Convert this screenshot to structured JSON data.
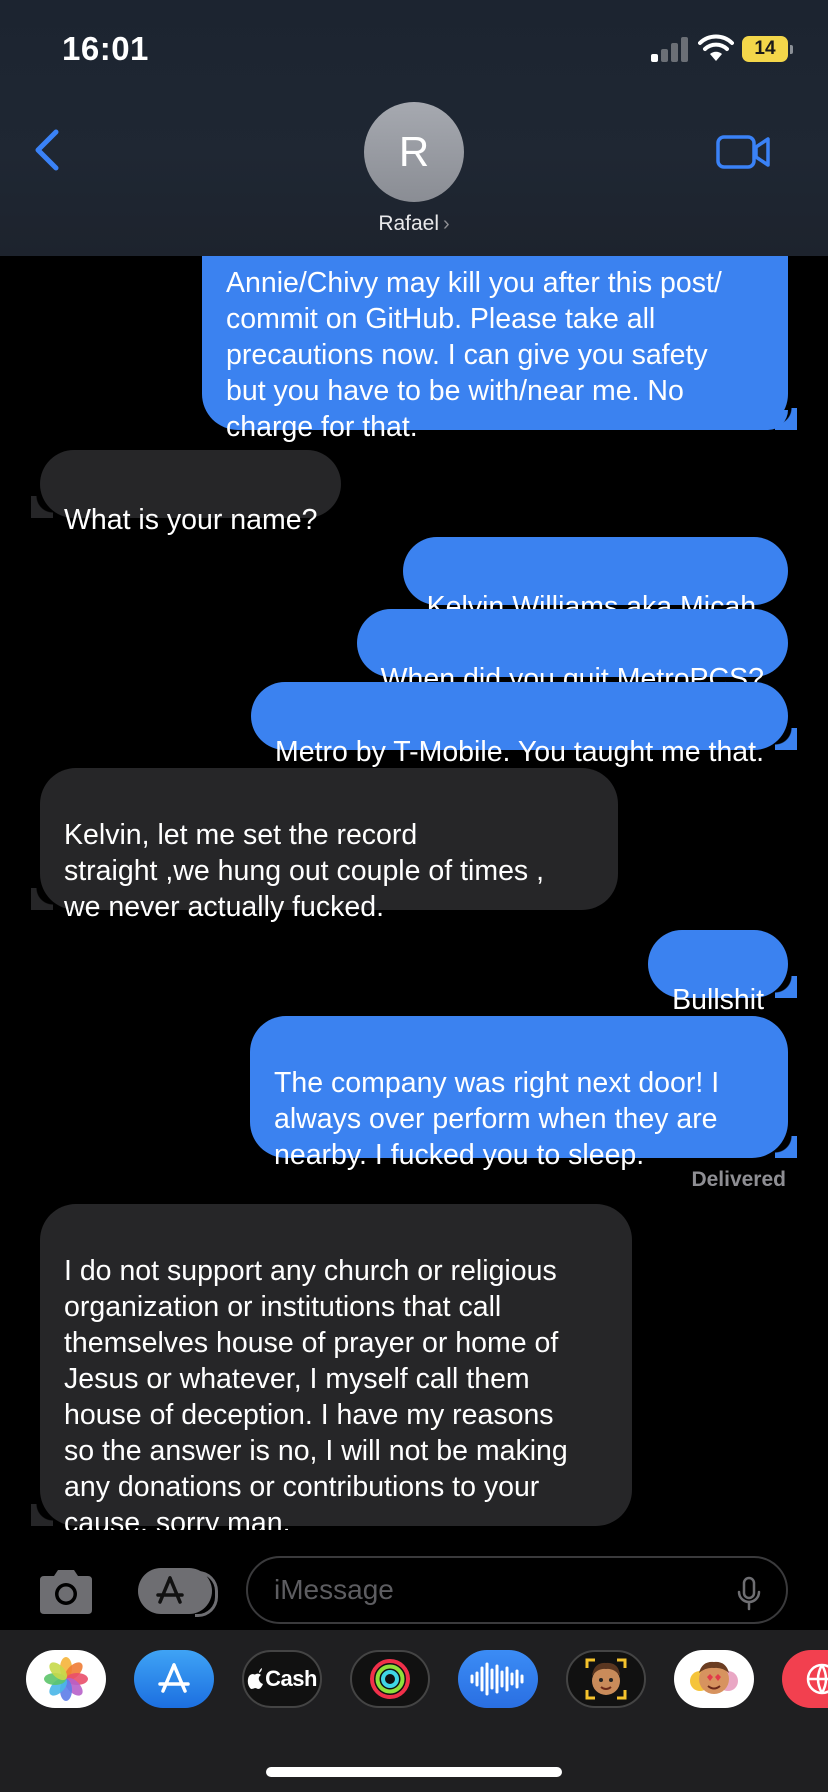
{
  "status_bar": {
    "time": "16:01",
    "battery": "14"
  },
  "header": {
    "contact_initial": "R",
    "contact_name": "Rafael",
    "name_chevron": "›",
    "icons": {
      "back": "chevron-left-icon",
      "video": "video-camera-icon"
    }
  },
  "messages": [
    {
      "direction": "sent",
      "text": "Annie/Chivy may kill you after this post/\ncommit on GitHub. Please take all\nprecautions now. I can give you safety\nbut you have to be with/near me. No\ncharge for that."
    },
    {
      "direction": "received",
      "text": "What is your name?"
    },
    {
      "direction": "sent",
      "text": "Kelvin Williams aka Micah."
    },
    {
      "direction": "sent",
      "text": "When did you quit MetroPCS?"
    },
    {
      "direction": "sent",
      "text": "Metro by T-Mobile. You taught me that."
    },
    {
      "direction": "received",
      "text": "Kelvin, let me set the record\nstraight ,we hung out couple of times ,\nwe never actually fucked."
    },
    {
      "direction": "sent",
      "text": "Bullshit"
    },
    {
      "direction": "sent",
      "text": "The company was right next door! I\nalways over perform when they are\nnearby. I fucked you to sleep."
    },
    {
      "direction": "received",
      "text": "I do not support any church or religious\norganization or institutions that call\nthemselves house of prayer or home of\nJesus or whatever, I myself call them\nhouse of deception. I have my reasons\nso the answer is no, I will not be making\nany donations or contributions to your\ncause, sorry man."
    }
  ],
  "delivery_status": "Delivered",
  "composer": {
    "placeholder": "iMessage",
    "icons": {
      "camera": "camera-icon",
      "apps": "app-store-icon",
      "mic": "microphone-icon"
    }
  },
  "app_drawer": {
    "apps": [
      {
        "name": "Photos",
        "icon": "photos-icon"
      },
      {
        "name": "App Store",
        "icon": "app-store-icon"
      },
      {
        "name": "Cash",
        "label": "Cash",
        "icon": "apple-cash-icon"
      },
      {
        "name": "Fitness",
        "icon": "activity-rings-icon"
      },
      {
        "name": "Audio",
        "icon": "audio-waveform-icon"
      },
      {
        "name": "Memoji",
        "icon": "memoji-icon"
      },
      {
        "name": "Animoji Stickers",
        "icon": "memoji-stickers-icon"
      },
      {
        "name": "Web",
        "icon": "globe-icon"
      }
    ]
  },
  "colors": {
    "sent_bubble": "#3b82f0",
    "received_bubble": "#262628",
    "accent": "#3a82f7",
    "battery": "#f3d64a"
  }
}
